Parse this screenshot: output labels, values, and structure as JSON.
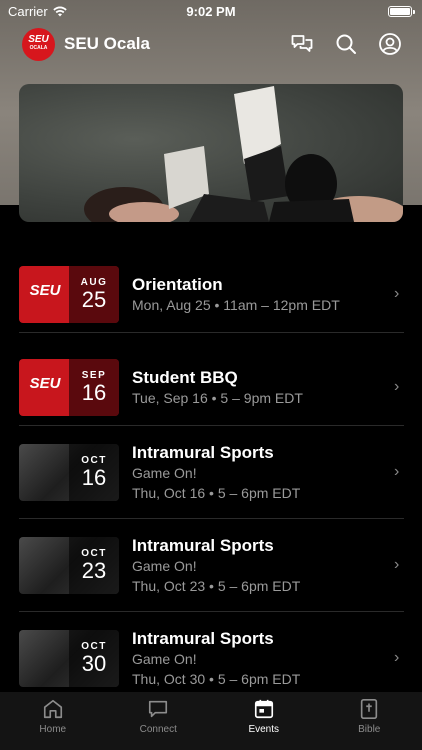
{
  "status": {
    "carrier": "Carrier",
    "time": "9:02 PM"
  },
  "header": {
    "title": "SEU Ocala",
    "logo_text": "SEU",
    "logo_sub": "OCALA"
  },
  "events": [
    {
      "month": "AUG",
      "day": "25",
      "title": "Orientation",
      "subtitle": "",
      "details": "Mon, Aug 25 • 11am – 12pm EDT",
      "thumb": "brand-seu-ocala"
    },
    {
      "month": "SEP",
      "day": "16",
      "title": "Student BBQ",
      "subtitle": "",
      "details": "Tue, Sep 16 • 5 – 9pm EDT",
      "thumb": "brand-seu"
    },
    {
      "month": "OCT",
      "day": "16",
      "title": "Intramural Sports",
      "subtitle": "Game On!",
      "details": "Thu, Oct 16 • 5 – 6pm EDT",
      "thumb": "photo-group"
    },
    {
      "month": "OCT",
      "day": "23",
      "title": "Intramural Sports",
      "subtitle": "Game On!",
      "details": "Thu, Oct 23 • 5 – 6pm EDT",
      "thumb": "photo-group"
    },
    {
      "month": "OCT",
      "day": "30",
      "title": "Intramural Sports",
      "subtitle": "Game On!",
      "details": "Thu, Oct 30 • 5 – 6pm EDT",
      "thumb": "photo-group"
    }
  ],
  "tabs": [
    {
      "label": "Home",
      "icon": "home-icon",
      "active": false
    },
    {
      "label": "Connect",
      "icon": "chat-icon",
      "active": false
    },
    {
      "label": "Events",
      "icon": "calendar-icon",
      "active": true
    },
    {
      "label": "Bible",
      "icon": "bible-icon",
      "active": false
    }
  ],
  "colors": {
    "brand_red": "#d7161d",
    "background": "#000000",
    "muted_text": "#9a9a9a"
  }
}
